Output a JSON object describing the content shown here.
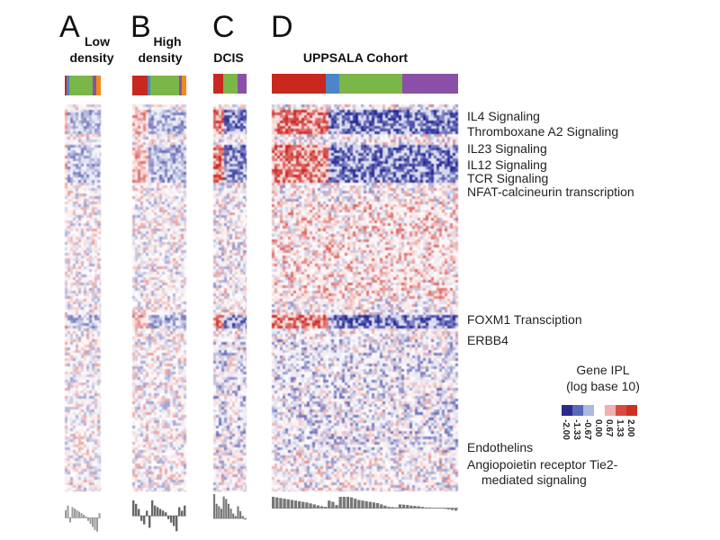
{
  "chart_data": {
    "type": "heatmap",
    "title": "",
    "panels": [
      {
        "letter": "A",
        "subtitle": [
          "Low",
          "density"
        ],
        "group_bar": [
          {
            "color": "#c8281e",
            "fraction": 0.05
          },
          {
            "color": "#4a86c8",
            "fraction": 0.07
          },
          {
            "color": "#7ab648",
            "fraction": 0.65
          },
          {
            "color": "#8a50a8",
            "fraction": 0.1
          },
          {
            "color": "#f08c1e",
            "fraction": 0.13
          }
        ],
        "intensity": 0.45,
        "score_profile": [
          0.5,
          0.8,
          -0.3,
          0.7,
          0.6,
          0.5,
          0.4,
          0.3,
          0.2,
          0.1,
          -0.2,
          -0.4,
          -0.6,
          -0.8,
          -0.9,
          0.3
        ],
        "score_shade": "#9a9a9a"
      },
      {
        "letter": "B",
        "subtitle": [
          "High",
          "density"
        ],
        "group_bar": [
          {
            "color": "#c8281e",
            "fraction": 0.28
          },
          {
            "color": "#4a86c8",
            "fraction": 0.06
          },
          {
            "color": "#7ab648",
            "fraction": 0.52
          },
          {
            "color": "#8a50a8",
            "fraction": 0.06
          },
          {
            "color": "#f08c1e",
            "fraction": 0.08
          }
        ],
        "intensity": 0.5,
        "score_profile": [
          0.9,
          0.7,
          0.4,
          -0.3,
          -0.5,
          0.3,
          -0.7,
          0.9,
          0.6,
          0.5,
          0.4,
          0.3,
          0.2,
          -0.2,
          -0.4,
          -0.6,
          -0.9,
          0.5,
          0.3,
          0.6
        ],
        "score_shade": "#666666"
      },
      {
        "letter": "C",
        "subtitle": [
          "DCIS"
        ],
        "group_bar": [
          {
            "color": "#c8281e",
            "fraction": 0.3
          },
          {
            "color": "#7ab648",
            "fraction": 0.44
          },
          {
            "color": "#8a50a8",
            "fraction": 0.26
          }
        ],
        "intensity": 0.85,
        "score_profile": [
          1.0,
          0.6,
          0.5,
          0.4,
          0.9,
          0.8,
          0.6,
          0.4,
          0.2,
          0.1,
          0.5,
          0.3,
          0.1,
          -0.05
        ],
        "score_shade": "#777777"
      },
      {
        "letter": "D",
        "subtitle": [
          "UPPSALA Cohort"
        ],
        "group_bar": [
          {
            "color": "#c8281e",
            "fraction": 0.29
          },
          {
            "color": "#4a86c8",
            "fraction": 0.07
          },
          {
            "color": "#7ab648",
            "fraction": 0.34
          },
          {
            "color": "#8a50a8",
            "fraction": 0.3
          }
        ],
        "intensity": 0.9,
        "score_profile": [
          0.95,
          0.85,
          0.8,
          0.75,
          0.7,
          0.65,
          0.6,
          0.55,
          0.5,
          0.45,
          0.38,
          0.3,
          0.22,
          0.15,
          0.1,
          0.6,
          0.5,
          0.25,
          1.0,
          0.95,
          0.9,
          0.85,
          0.75,
          0.65,
          0.6,
          0.55,
          0.5,
          0.45,
          0.4,
          0.3,
          0.2,
          0.1,
          0.08,
          0.05,
          0.3,
          0.28,
          0.25,
          0.2,
          0.18,
          0.15,
          0.1,
          0.05,
          0.05,
          0.03,
          0.02,
          0.02,
          -0.05,
          -0.1,
          -0.15,
          -0.2
        ],
        "score_shade": "#777777"
      }
    ],
    "row_labels": [
      {
        "label": "IL4 Signaling",
        "row_fraction": 0.03
      },
      {
        "label": "Thromboxane A2 Signaling",
        "row_fraction": 0.07
      },
      {
        "label": "IL23 Signaling",
        "row_fraction": 0.115
      },
      {
        "label": "IL12 Signaling",
        "row_fraction": 0.155
      },
      {
        "label": "TCR Signaling",
        "row_fraction": 0.19
      },
      {
        "label": "NFAT-calcineurin transcription",
        "row_fraction": 0.225
      },
      {
        "label": "FOXM1 Transciption",
        "row_fraction": 0.555
      },
      {
        "label": "ERBB4",
        "row_fraction": 0.61
      },
      {
        "label": "Endothelins",
        "row_fraction": 0.885
      },
      {
        "label": "Angiopoietin receptor Tie2-",
        "row_fraction": 0.93
      },
      {
        "label": "mediated signaling",
        "row_fraction": 0.97
      }
    ],
    "legend": {
      "title_line1": "Gene IPL",
      "title_line2": "(log base 10)",
      "ticks": [
        "-2.00",
        "-1.33",
        "-0.67",
        "0.00",
        "0.67",
        "1.33",
        "2.00"
      ],
      "colors": [
        "#2a2a8c",
        "#5a6ab8",
        "#aab8e2",
        "#ffffff",
        "#eeb0b0",
        "#d84c40",
        "#d03020"
      ],
      "range": [
        -2.0,
        2.0
      ]
    }
  }
}
